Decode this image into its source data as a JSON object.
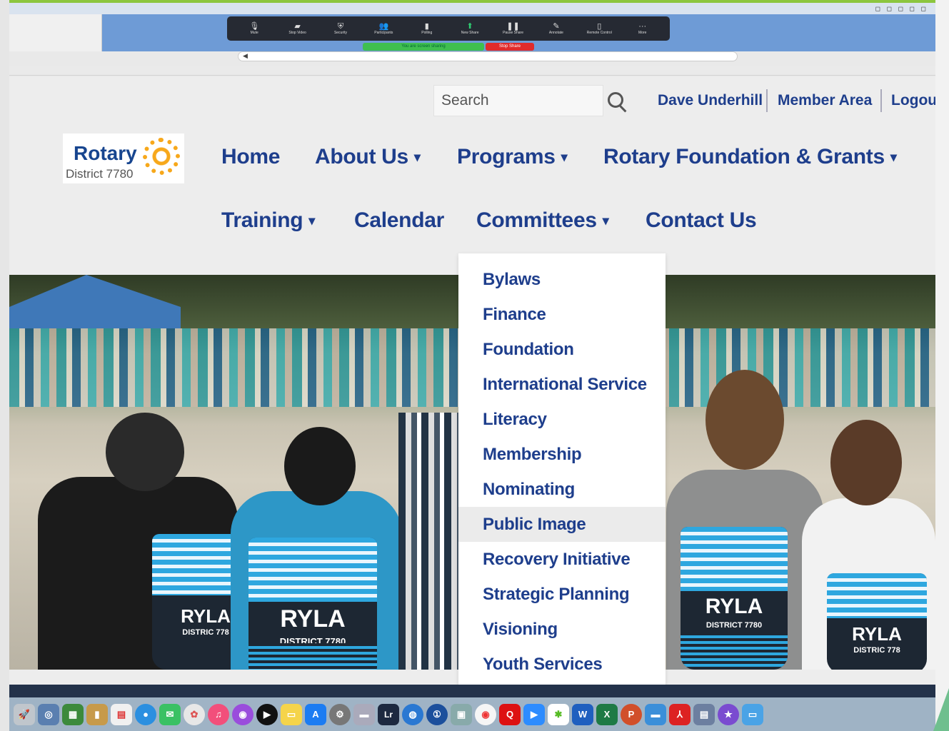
{
  "zoom_toolbar": {
    "buttons": [
      {
        "label": "Mute",
        "icon": "microphone-icon"
      },
      {
        "label": "Stop Video",
        "icon": "video-icon"
      },
      {
        "label": "Security",
        "icon": "shield-icon"
      },
      {
        "label": "Participants",
        "icon": "participants-icon"
      },
      {
        "label": "Polling",
        "icon": "poll-icon"
      },
      {
        "label": "New Share",
        "icon": "share-icon"
      },
      {
        "label": "Pause Share",
        "icon": "pause-icon"
      },
      {
        "label": "Annotate",
        "icon": "pencil-icon"
      },
      {
        "label": "Remote Control",
        "icon": "remote-icon"
      },
      {
        "label": "More",
        "icon": "more-icon"
      }
    ],
    "share_indicator": "You are screen sharing",
    "stop_share": "Stop Share",
    "share_color": "#3fbf4f",
    "stop_color": "#e02b2b"
  },
  "site": {
    "search": {
      "placeholder": "Search"
    },
    "utility": {
      "user": "Dave Underhill",
      "member_area": "Member Area",
      "logout": "Logout"
    },
    "logo": {
      "word": "Rotary",
      "sub": "District 7780"
    },
    "nav": {
      "home": "Home",
      "about": "About Us",
      "programs": "Programs",
      "foundation": "Rotary Foundation & Grants",
      "training": "Training",
      "calendar": "Calendar",
      "committees": "Committees",
      "contact": "Contact Us",
      "caret": "▾"
    },
    "committees_menu": [
      "Bylaws",
      "Finance",
      "Foundation",
      "International Service",
      "Literacy",
      "Membership",
      "Nominating",
      "Public Image",
      "Recovery Initiative",
      "Strategic Planning",
      "Visioning",
      "Youth Services"
    ],
    "hero_bags": {
      "bag1_top": "RYLA",
      "bag1_bottom": "DISTRICT 7780",
      "bag2_top": "RYLA",
      "bag2_bottom": "DISTRIC 778",
      "bag3_top": "RYLA",
      "bag3_bottom": "DISTRICT 7780",
      "bag4_top": "RYLA",
      "bag4_bottom": "DISTRIC 778"
    },
    "colors": {
      "link": "#1e3e8c",
      "accent": "#f7a81b",
      "bag_blue": "#2ea7df"
    }
  },
  "dock": {
    "lightroom": "Lr",
    "quicken": "Q"
  }
}
